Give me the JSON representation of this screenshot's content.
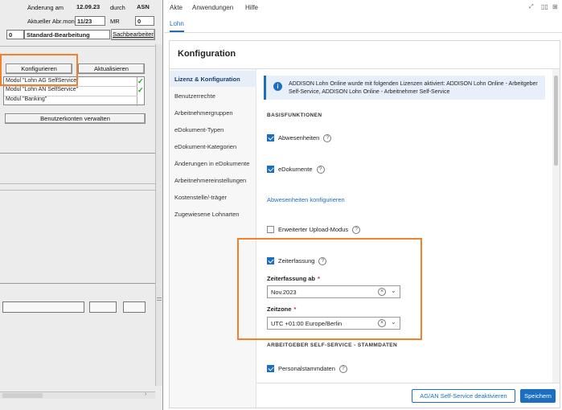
{
  "legacy": {
    "row1_label": "Änderung am",
    "row1_date": "12.09.23",
    "row1_by_label": "durch",
    "row1_by": "ASN",
    "row2_label": "Aktueller Abr.monat",
    "row2_value": "11/23",
    "row2_mr_label": "MR",
    "row2_mr": "0",
    "row3_code": "0",
    "row3_value": "Standard-Bearbeitung",
    "row3_button": "Sachbearbeiter",
    "konfigurieren": "Konfigurieren",
    "aktualisieren": "Aktualisieren",
    "modules": [
      {
        "label": "Modul \"Lohn AG SelfService\"",
        "check": "✓"
      },
      {
        "label": "Modul \"Lohn AN SelfService\"",
        "check": "✓"
      },
      {
        "label": "Modul \"Banking\"",
        "check": ""
      }
    ],
    "benutzerkonten": "Benutzerkonten verwalten"
  },
  "menu": [
    "Akte",
    "Anwendungen",
    "Hilfe"
  ],
  "tab": "Lohn",
  "panel_title": "Konfiguration",
  "nav": [
    "Lizenz & Konfiguration",
    "Benutzerrechte",
    "Arbeitnehmergruppen",
    "eDokument-Typen",
    "eDokument-Kategorien",
    "Änderungen in eDokumente",
    "Arbeitnehmereinstellungen",
    "Kostenstelle/-träger",
    "Zugewiesene Lohnarten"
  ],
  "info": "ADDISON Lohn Online wurde mit folgenden Lizenzen aktiviert: ADDISON Lohn Online - Arbeitgeber Self-Service, ADDISON Lohn Online - Arbeitnehmer Self-Service",
  "basis_heading": "BASISFUNKTIONEN",
  "abwesenheiten": "Abwesenheiten",
  "edokumente": "eDokumente",
  "abwesenheiten_link": "Abwesenheiten konfigurieren",
  "upload": "Erweiterter Upload-Modus",
  "zeiterfassung": "Zeiterfassung",
  "zeiterfassung_ab_label": "Zeiterfassung ab",
  "zeiterfassung_ab_value": "Nov.2023",
  "zeitzone_label": "Zeitzone",
  "zeitzone_value": "UTC +01:00 Europe/Berlin",
  "required_mark": "*",
  "help_mark": "?",
  "ag_heading": "ARBEITGEBER SELF-SERVICE - STAMMDATEN",
  "personalstammdaten": "Personalstammdaten",
  "btn_deactivate": "AG/AN Self-Service deaktivieren",
  "btn_save": "Speichern",
  "colors": {
    "accent": "#1b6ec2",
    "highlight": "#f0812e"
  }
}
